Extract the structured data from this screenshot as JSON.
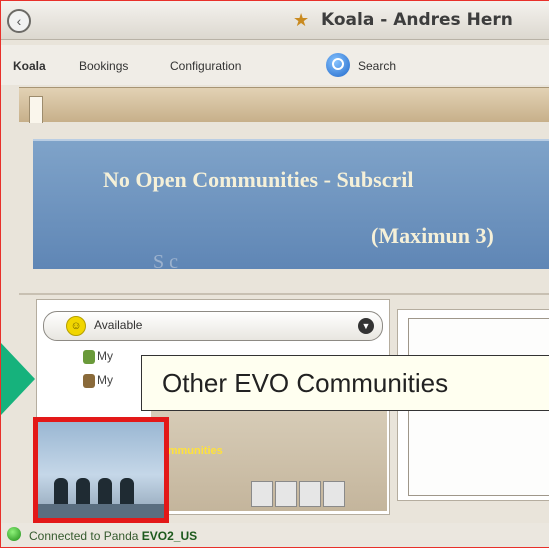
{
  "window": {
    "title": "Koala - Andres Hern",
    "back_icon": "back-arrow-icon",
    "app_icon": "koala-app-icon"
  },
  "menu": {
    "koala": "Koala",
    "bookings": "Bookings",
    "configuration": "Configuration",
    "search": "Search",
    "search_icon": "magnifier-icon"
  },
  "banner": {
    "line1": "No Open Communities - Subscril",
    "line2": "(Maximun 3)",
    "ghost": "S          c"
  },
  "status": {
    "selected": "Available",
    "icon": "smiley-icon"
  },
  "tree": {
    "item1": "My",
    "item2": "My",
    "community_label": "ommunities"
  },
  "tooltip": {
    "text": "Other EVO Communities"
  },
  "footer": {
    "prefix": "Connected to Panda",
    "server": "EVO2_US"
  },
  "colors": {
    "accent": "#16b27c",
    "highlight": "#e31818",
    "banner": "#6f93c0"
  }
}
